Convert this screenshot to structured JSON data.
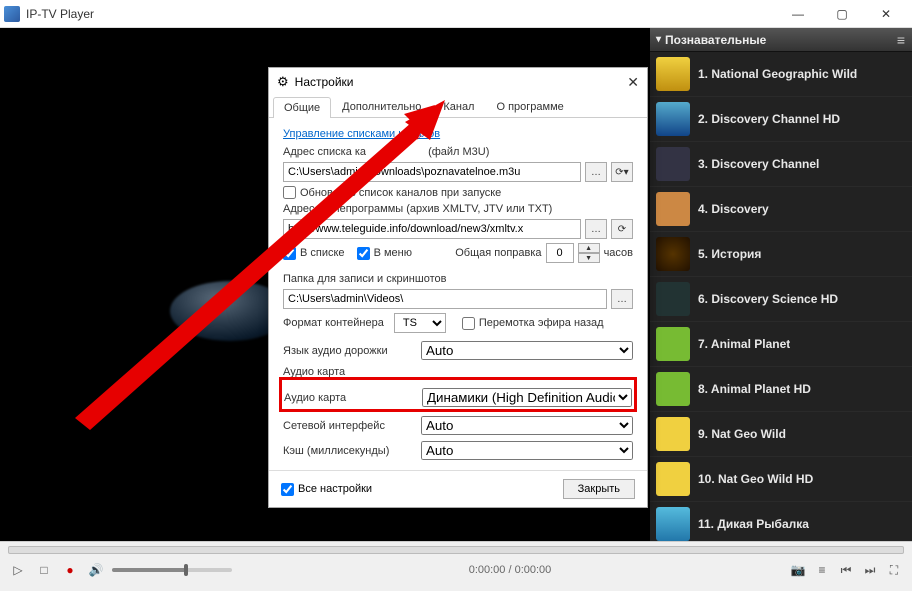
{
  "window": {
    "title": "IP-TV Player"
  },
  "sidebar": {
    "category": "Познавательные",
    "channels": [
      {
        "n": "1",
        "name": "National Geographic Wild"
      },
      {
        "n": "2",
        "name": "Discovery Channel HD"
      },
      {
        "n": "3",
        "name": "Discovery Channel"
      },
      {
        "n": "4",
        "name": "Discovery"
      },
      {
        "n": "5",
        "name": "История"
      },
      {
        "n": "6",
        "name": "Discovery Science HD"
      },
      {
        "n": "7",
        "name": "Animal Planet"
      },
      {
        "n": "8",
        "name": "Animal Planet HD"
      },
      {
        "n": "9",
        "name": "Nat Geo Wild"
      },
      {
        "n": "10",
        "name": "Nat Geo Wild HD"
      },
      {
        "n": "11",
        "name": "Дикая Рыбалка"
      }
    ]
  },
  "settings": {
    "title": "Настройки",
    "tabs": {
      "general": "Общие",
      "extra": "Дополнительно",
      "channel": "Канал",
      "about": "О программе"
    },
    "manage_link": "Управление списками каналов",
    "m3u_label_tail": " (файл M3U)",
    "m3u_label_head": "Адрес списка ка",
    "m3u_path": "C:\\Users\\admin\\Downloads\\poznavatelnoe.m3u",
    "refresh_cb": "Обновлять список каналов при запуске",
    "tvg_label_head": "Адрес",
    "tvg_label_tail": "телепрограммы (архив XMLTV, JTV или TXT)",
    "tvg_url": "http://www.teleguide.info/download/new3/xmltv.x",
    "in_list": "В списке",
    "in_menu": "В меню",
    "offset_label": "Общая поправка",
    "offset_value": "0",
    "offset_unit": "часов",
    "rec_folder_label": "Папка для записи и скриншотов",
    "rec_folder": "C:\\Users\\admin\\Videos\\",
    "container_label": "Формат контейнера",
    "container_value": "TS",
    "rewind_cb": "Перемотка эфира назад",
    "lang_label": "Язык аудио дорожки",
    "lang_value": "Auto",
    "audio_label": "Аудио карта",
    "audio_value": "Динамики (High Definition Audio De",
    "net_label": "Сетевой интерфейс",
    "net_value": "Auto",
    "cache_label": "Кэш (миллисекунды)",
    "cache_value": "Auto",
    "all_settings": "Все настройки",
    "close_btn": "Закрыть"
  },
  "player": {
    "time": "0:00:00 / 0:00:00"
  }
}
